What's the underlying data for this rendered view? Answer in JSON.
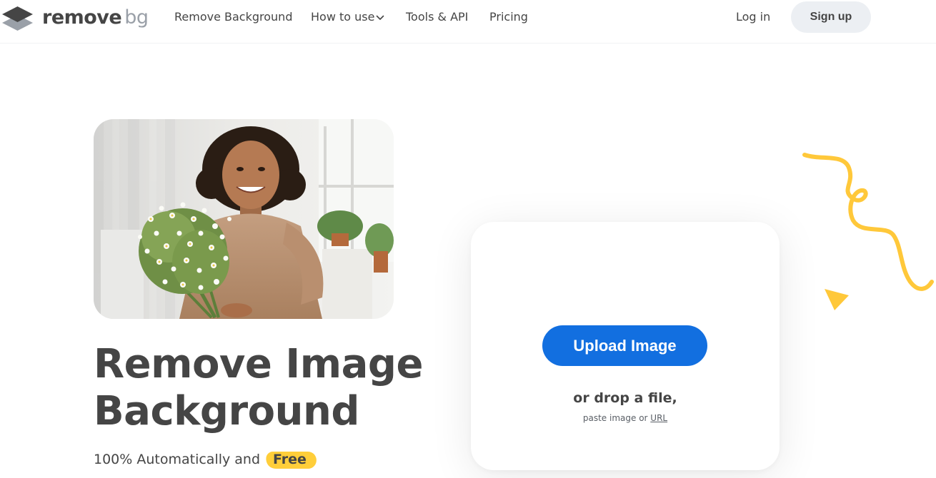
{
  "header": {
    "logo_word1": "remove",
    "logo_word2": "bg",
    "nav": {
      "remove_background": "Remove Background",
      "how_to_use": "How to use",
      "tools_api": "Tools & API",
      "pricing": "Pricing"
    },
    "login": "Log in",
    "signup": "Sign up"
  },
  "hero": {
    "title_line1": "Remove Image",
    "title_line2": "Background",
    "subtitle": "100% Automatically and",
    "free_badge": "Free"
  },
  "upload": {
    "button_label": "Upload Image",
    "drop_text": "or drop a file,",
    "paste_prefix": "paste image or",
    "url_link": "URL"
  },
  "colors": {
    "accent_blue": "#126fe0",
    "accent_yellow": "#ffce3a",
    "text_dark": "#454545",
    "logo_gray": "#9aa0a8",
    "signup_bg": "#eceff3"
  },
  "icons": {
    "logo": "layered-diamond-logo-icon",
    "how_to_use_dropdown": "chevron-down-icon",
    "decoration_squiggle": "yellow-squiggle-icon",
    "decoration_triangle": "yellow-triangle-icon"
  }
}
